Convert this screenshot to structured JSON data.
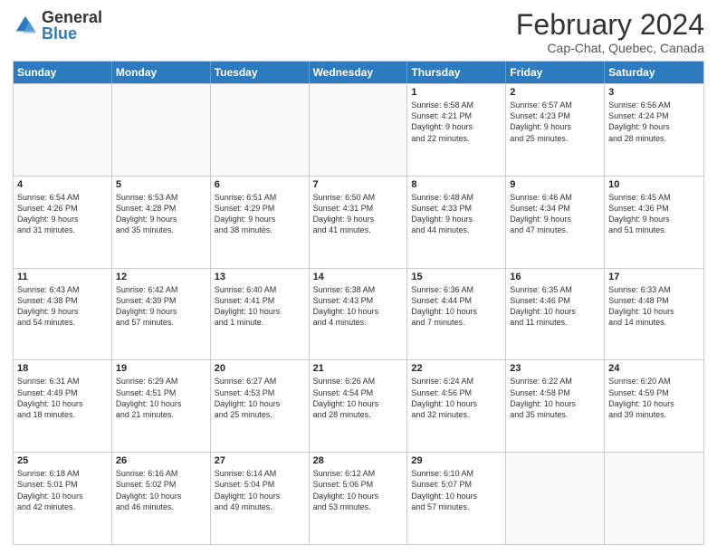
{
  "logo": {
    "general": "General",
    "blue": "Blue"
  },
  "title": "February 2024",
  "subtitle": "Cap-Chat, Quebec, Canada",
  "header_days": [
    "Sunday",
    "Monday",
    "Tuesday",
    "Wednesday",
    "Thursday",
    "Friday",
    "Saturday"
  ],
  "weeks": [
    [
      {
        "day": "",
        "info": ""
      },
      {
        "day": "",
        "info": ""
      },
      {
        "day": "",
        "info": ""
      },
      {
        "day": "",
        "info": ""
      },
      {
        "day": "1",
        "info": "Sunrise: 6:58 AM\nSunset: 4:21 PM\nDaylight: 9 hours\nand 22 minutes."
      },
      {
        "day": "2",
        "info": "Sunrise: 6:57 AM\nSunset: 4:23 PM\nDaylight: 9 hours\nand 25 minutes."
      },
      {
        "day": "3",
        "info": "Sunrise: 6:56 AM\nSunset: 4:24 PM\nDaylight: 9 hours\nand 28 minutes."
      }
    ],
    [
      {
        "day": "4",
        "info": "Sunrise: 6:54 AM\nSunset: 4:26 PM\nDaylight: 9 hours\nand 31 minutes."
      },
      {
        "day": "5",
        "info": "Sunrise: 6:53 AM\nSunset: 4:28 PM\nDaylight: 9 hours\nand 35 minutes."
      },
      {
        "day": "6",
        "info": "Sunrise: 6:51 AM\nSunset: 4:29 PM\nDaylight: 9 hours\nand 38 minutes."
      },
      {
        "day": "7",
        "info": "Sunrise: 6:50 AM\nSunset: 4:31 PM\nDaylight: 9 hours\nand 41 minutes."
      },
      {
        "day": "8",
        "info": "Sunrise: 6:48 AM\nSunset: 4:33 PM\nDaylight: 9 hours\nand 44 minutes."
      },
      {
        "day": "9",
        "info": "Sunrise: 6:46 AM\nSunset: 4:34 PM\nDaylight: 9 hours\nand 47 minutes."
      },
      {
        "day": "10",
        "info": "Sunrise: 6:45 AM\nSunset: 4:36 PM\nDaylight: 9 hours\nand 51 minutes."
      }
    ],
    [
      {
        "day": "11",
        "info": "Sunrise: 6:43 AM\nSunset: 4:38 PM\nDaylight: 9 hours\nand 54 minutes."
      },
      {
        "day": "12",
        "info": "Sunrise: 6:42 AM\nSunset: 4:39 PM\nDaylight: 9 hours\nand 57 minutes."
      },
      {
        "day": "13",
        "info": "Sunrise: 6:40 AM\nSunset: 4:41 PM\nDaylight: 10 hours\nand 1 minute."
      },
      {
        "day": "14",
        "info": "Sunrise: 6:38 AM\nSunset: 4:43 PM\nDaylight: 10 hours\nand 4 minutes."
      },
      {
        "day": "15",
        "info": "Sunrise: 6:36 AM\nSunset: 4:44 PM\nDaylight: 10 hours\nand 7 minutes."
      },
      {
        "day": "16",
        "info": "Sunrise: 6:35 AM\nSunset: 4:46 PM\nDaylight: 10 hours\nand 11 minutes."
      },
      {
        "day": "17",
        "info": "Sunrise: 6:33 AM\nSunset: 4:48 PM\nDaylight: 10 hours\nand 14 minutes."
      }
    ],
    [
      {
        "day": "18",
        "info": "Sunrise: 6:31 AM\nSunset: 4:49 PM\nDaylight: 10 hours\nand 18 minutes."
      },
      {
        "day": "19",
        "info": "Sunrise: 6:29 AM\nSunset: 4:51 PM\nDaylight: 10 hours\nand 21 minutes."
      },
      {
        "day": "20",
        "info": "Sunrise: 6:27 AM\nSunset: 4:53 PM\nDaylight: 10 hours\nand 25 minutes."
      },
      {
        "day": "21",
        "info": "Sunrise: 6:26 AM\nSunset: 4:54 PM\nDaylight: 10 hours\nand 28 minutes."
      },
      {
        "day": "22",
        "info": "Sunrise: 6:24 AM\nSunset: 4:56 PM\nDaylight: 10 hours\nand 32 minutes."
      },
      {
        "day": "23",
        "info": "Sunrise: 6:22 AM\nSunset: 4:58 PM\nDaylight: 10 hours\nand 35 minutes."
      },
      {
        "day": "24",
        "info": "Sunrise: 6:20 AM\nSunset: 4:59 PM\nDaylight: 10 hours\nand 39 minutes."
      }
    ],
    [
      {
        "day": "25",
        "info": "Sunrise: 6:18 AM\nSunset: 5:01 PM\nDaylight: 10 hours\nand 42 minutes."
      },
      {
        "day": "26",
        "info": "Sunrise: 6:16 AM\nSunset: 5:02 PM\nDaylight: 10 hours\nand 46 minutes."
      },
      {
        "day": "27",
        "info": "Sunrise: 6:14 AM\nSunset: 5:04 PM\nDaylight: 10 hours\nand 49 minutes."
      },
      {
        "day": "28",
        "info": "Sunrise: 6:12 AM\nSunset: 5:06 PM\nDaylight: 10 hours\nand 53 minutes."
      },
      {
        "day": "29",
        "info": "Sunrise: 6:10 AM\nSunset: 5:07 PM\nDaylight: 10 hours\nand 57 minutes."
      },
      {
        "day": "",
        "info": ""
      },
      {
        "day": "",
        "info": ""
      }
    ]
  ]
}
